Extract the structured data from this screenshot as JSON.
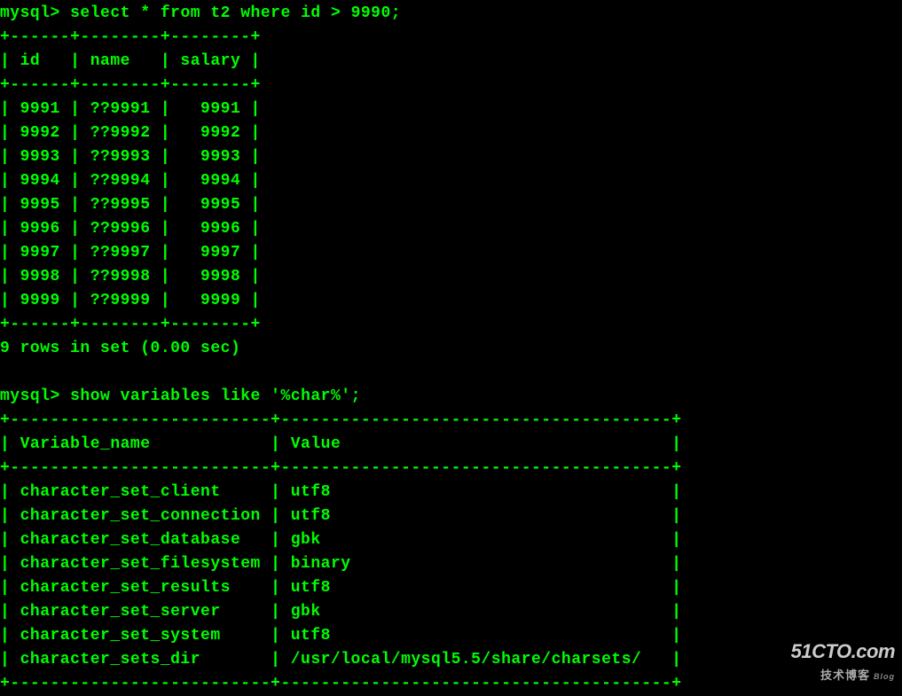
{
  "prompt1": "mysql> ",
  "query1": "select * from t2 where id > 9990;",
  "table1": {
    "border_top": "+------+--------+--------+",
    "headers": "| id   | name   | salary |",
    "border_mid": "+------+--------+--------+",
    "rows": [
      "| 9991 | ??9991 |   9991 |",
      "| 9992 | ??9992 |   9992 |",
      "| 9993 | ??9993 |   9993 |",
      "| 9994 | ??9994 |   9994 |",
      "| 9995 | ??9995 |   9995 |",
      "| 9996 | ??9996 |   9996 |",
      "| 9997 | ??9997 |   9997 |",
      "| 9998 | ??9998 |   9998 |",
      "| 9999 | ??9999 |   9999 |"
    ],
    "border_bot": "+------+--------+--------+"
  },
  "result1": "9 rows in set (0.00 sec)",
  "prompt2": "mysql> ",
  "query2": "show variables like '%char%';",
  "table2": {
    "border_top": "+--------------------------+---------------------------------------+",
    "headers": "| Variable_name            | Value                                 |",
    "border_mid": "+--------------------------+---------------------------------------+",
    "rows": [
      "| character_set_client     | utf8                                  |",
      "| character_set_connection | utf8                                  |",
      "| character_set_database   | gbk                                   |",
      "| character_set_filesystem | binary                                |",
      "| character_set_results    | utf8                                  |",
      "| character_set_server     | gbk                                   |",
      "| character_set_system     | utf8                                  |",
      "| character_sets_dir       | /usr/local/mysql5.5/share/charsets/   |"
    ],
    "border_bot": "+--------------------------+---------------------------------------+"
  },
  "watermark": {
    "main": "51CTO.com",
    "sub": "技术博客",
    "blog": "Blog"
  }
}
